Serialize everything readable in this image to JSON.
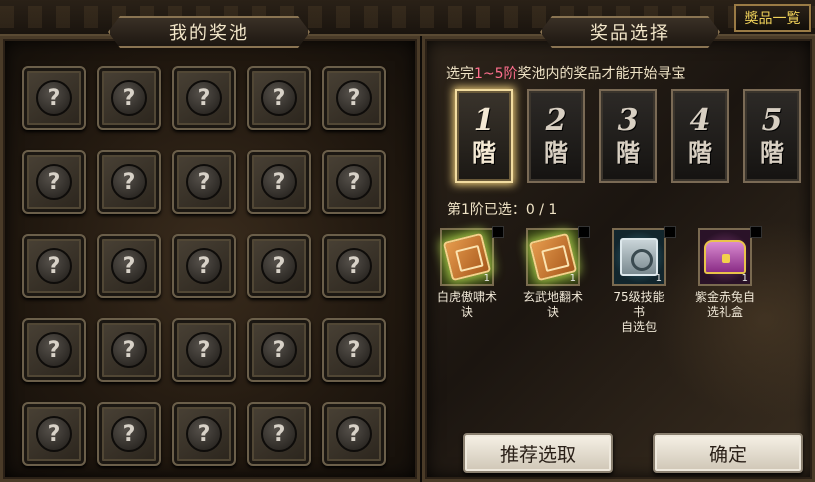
{
  "header": {
    "my_pool_title": "我的奖池",
    "reward_select_title": "奖品选择",
    "catalog_button": "奬品一覧"
  },
  "pool": {
    "slot_symbol": "?",
    "slots": 25
  },
  "selection": {
    "hint_prefix": "选完",
    "hint_range": "1~5阶",
    "hint_suffix": "奖池内的奖品才能开始寻宝",
    "tier_unit": "階",
    "tiers": [
      {
        "num": "1",
        "selected": true
      },
      {
        "num": "2",
        "selected": false
      },
      {
        "num": "3",
        "selected": false
      },
      {
        "num": "4",
        "selected": false
      },
      {
        "num": "5",
        "selected": false
      }
    ],
    "progress": "第1阶已选：0 / 1"
  },
  "rewards": [
    {
      "name_line1": "白虎傲啸术",
      "name_line2": "诀",
      "count": "1",
      "icon": "skill-book-icon"
    },
    {
      "name_line1": "玄武地翻术",
      "name_line2": "诀",
      "count": "1",
      "icon": "skill-book-icon"
    },
    {
      "name_line1": "75级技能书",
      "name_line2": "自选包",
      "count": "1",
      "icon": "silver-safe-icon"
    },
    {
      "name_line1": "紫金赤兔自",
      "name_line2": "选礼盒",
      "count": "1",
      "icon": "treasure-chest-icon"
    }
  ],
  "buttons": {
    "recommend": "推荐选取",
    "confirm": "确定"
  },
  "colors": {
    "highlight_range": "#ff6f8e",
    "catalog_text": "#f0d25a",
    "selected_glow": "#e8c877"
  }
}
